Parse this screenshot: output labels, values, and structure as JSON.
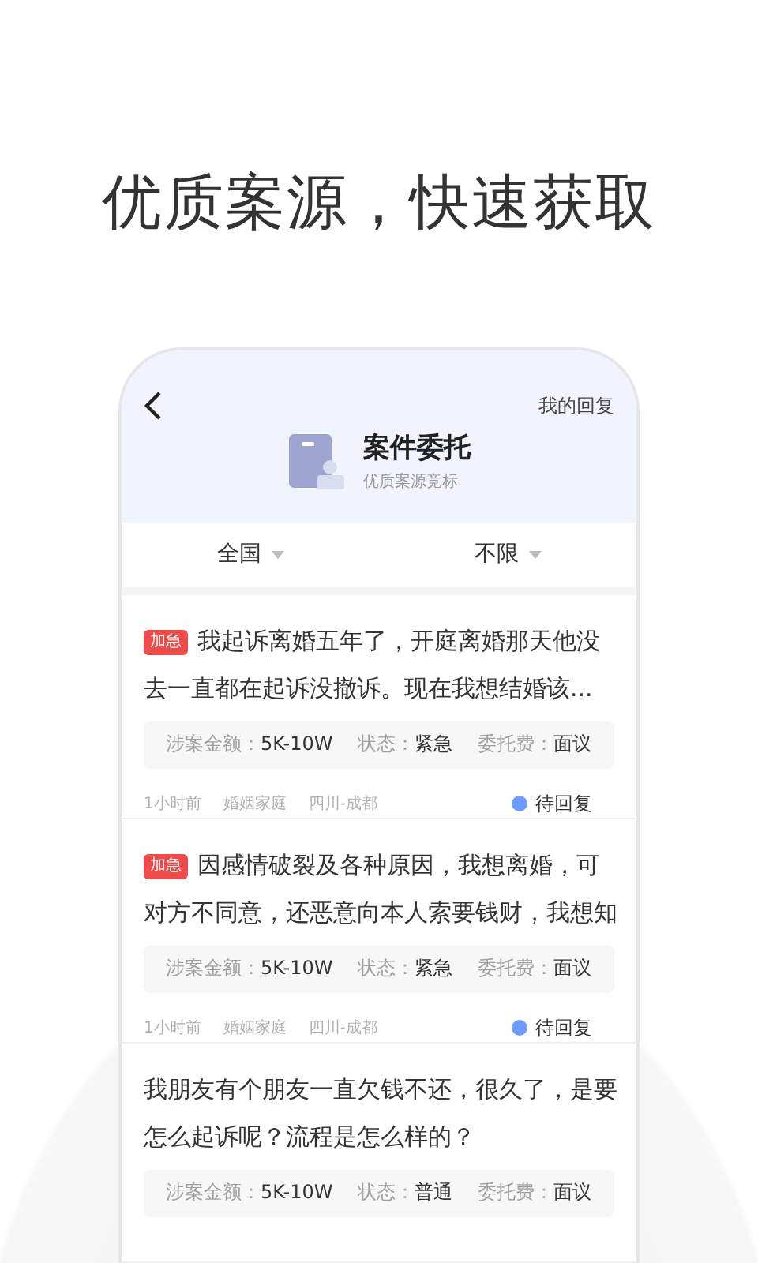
{
  "headline": "优质案源，快速获取",
  "header": {
    "title": "案件委托",
    "subtitle": "优质案源竞标",
    "action": "我的回复"
  },
  "filters": [
    {
      "label": "全国"
    },
    {
      "label": "不限"
    }
  ],
  "cases": [
    {
      "tag": "加急",
      "title": "我起诉离婚五年了，开庭离婚那天他没去一直都在起诉没撤诉。现在我想结婚该...",
      "meta": [
        {
          "label": "涉案金额：",
          "value": "5K-10W"
        },
        {
          "label": "状态：",
          "value": "紧急"
        },
        {
          "label": "委托费：",
          "value": "面议"
        }
      ],
      "footer": {
        "time": "1小时前",
        "category": "婚姻家庭",
        "location": "四川-成都",
        "status": "待回复"
      }
    },
    {
      "tag": "加急",
      "title": "因感情破裂及各种原因，我想离婚，可对方不同意，还恶意向本人索要钱财，我想知",
      "meta": [
        {
          "label": "涉案金额：",
          "value": "5K-10W"
        },
        {
          "label": "状态：",
          "value": "紧急"
        },
        {
          "label": "委托费：",
          "value": "面议"
        }
      ],
      "footer": {
        "time": "1小时前",
        "category": "婚姻家庭",
        "location": "四川-成都",
        "status": "待回复"
      }
    },
    {
      "title": "我朋友有个朋友一直欠钱不还，很久了，是要怎么起诉呢？流程是怎么样的？",
      "meta": [
        {
          "label": "涉案金额：",
          "value": "5K-10W"
        },
        {
          "label": "状态：",
          "value": "普通"
        },
        {
          "label": "委托费：",
          "value": "面议"
        }
      ]
    }
  ]
}
